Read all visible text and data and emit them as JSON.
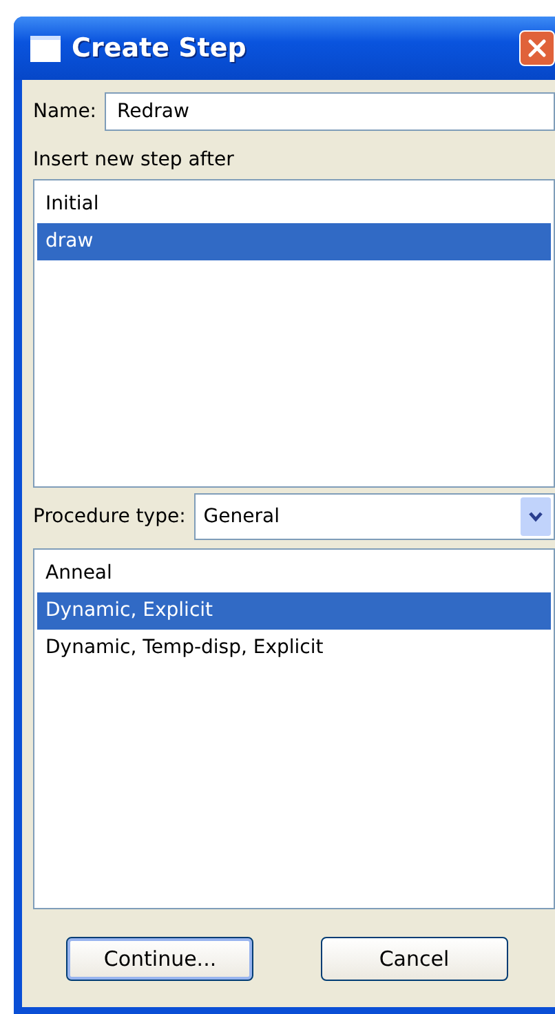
{
  "window": {
    "title": "Create Step"
  },
  "name_field": {
    "label": "Name:",
    "value": "Redraw"
  },
  "insert_after": {
    "label": "Insert new step after",
    "items": [
      {
        "label": "Initial",
        "selected": false
      },
      {
        "label": "draw",
        "selected": true
      }
    ]
  },
  "procedure_type": {
    "label": "Procedure type:",
    "value": "General"
  },
  "procedures": [
    {
      "label": "Anneal",
      "selected": false
    },
    {
      "label": "Dynamic, Explicit",
      "selected": true
    },
    {
      "label": "Dynamic, Temp-disp, Explicit",
      "selected": false
    }
  ],
  "buttons": [
    {
      "label": "Continue...",
      "default": true
    },
    {
      "label": "Cancel",
      "default": false
    }
  ]
}
